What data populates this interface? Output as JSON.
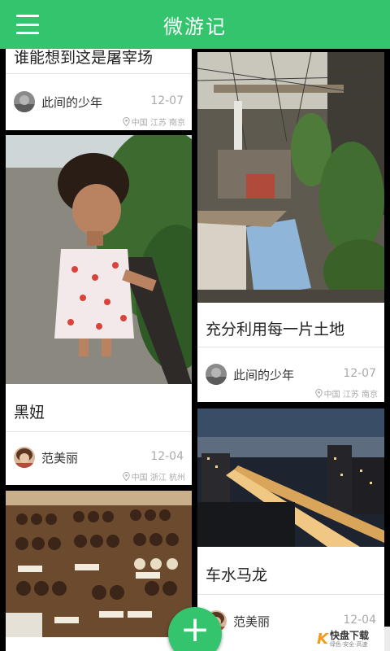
{
  "appbar": {
    "title": "微游记",
    "menu_icon": "hamburger-menu-icon",
    "accent": "#35c46e"
  },
  "cards": [
    {
      "caption": "谁能想到这是屠宰场",
      "author": "此间的少年",
      "date": "12-07",
      "location": "中国 江苏 南京"
    },
    {
      "caption": "充分利用每一片土地",
      "author": "此间的少年",
      "date": "12-07",
      "location": "中国 江苏 南京"
    },
    {
      "caption": "黑妞",
      "author": "范美丽",
      "date": "12-04",
      "location": "中国 浙江 杭州"
    },
    {
      "caption": "车水马龙",
      "author": "范美丽",
      "date": "12-04"
    }
  ],
  "fab": {
    "label": "+"
  },
  "watermark": {
    "mark": "K",
    "brand": "快盘下载",
    "tagline": "绿色·安全·高速"
  }
}
